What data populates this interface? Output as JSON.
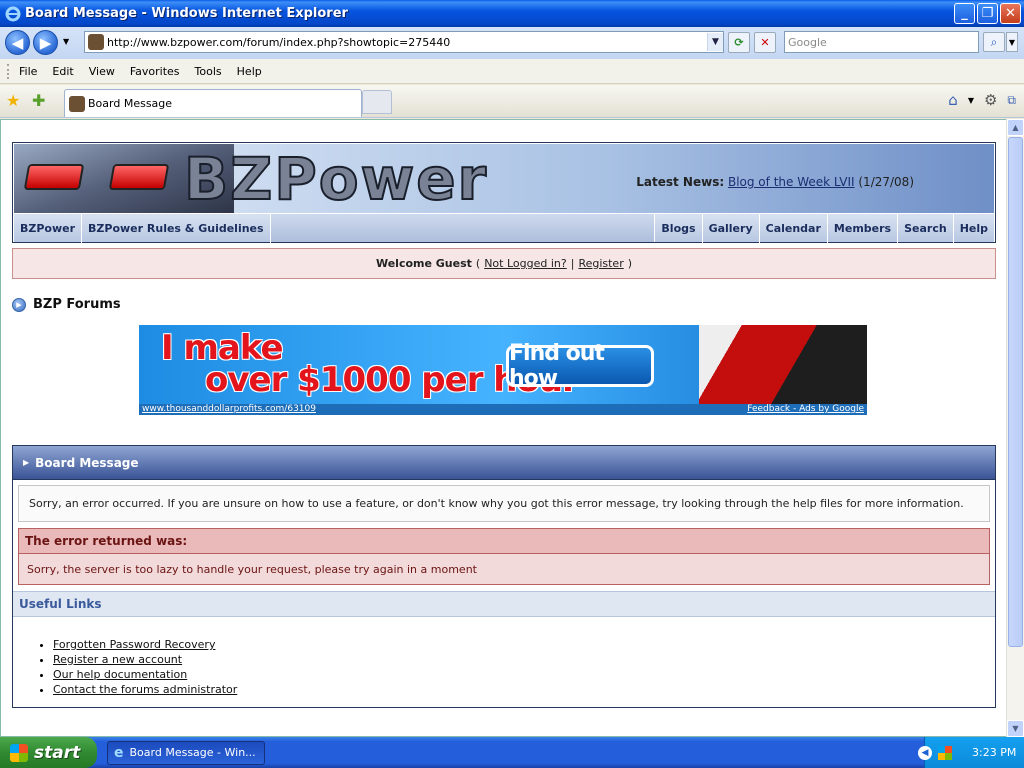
{
  "window": {
    "title": "Board Message - Windows Internet Explorer",
    "min": "_",
    "max": "❐",
    "close": "✕"
  },
  "address": {
    "url": "http://www.bzpower.com/forum/index.php?showtopic=275440"
  },
  "search": {
    "placeholder": "Google"
  },
  "menu": [
    "File",
    "Edit",
    "View",
    "Favorites",
    "Tools",
    "Help"
  ],
  "tab": {
    "label": "Board Message"
  },
  "site": {
    "logo": "BZPower",
    "news_label": "Latest News:",
    "news_link": "Blog of the Week LVII",
    "news_date": "(1/27/08)",
    "nav_left": [
      "BZPower",
      "BZPower Rules & Guidelines"
    ],
    "nav_right": [
      "Blogs",
      "Gallery",
      "Calendar",
      "Members",
      "Search",
      "Help"
    ]
  },
  "welcome": {
    "greeting": "Welcome Guest",
    "open": "(",
    "not_logged": "Not Logged in?",
    "sep": "|",
    "register": "Register",
    "close": ")"
  },
  "crumb": "BZP Forums",
  "ad": {
    "line1": "I make",
    "line2": "over $1000 per hour",
    "cta": "Find out how",
    "url": "www.thousanddollarprofits.com/63109",
    "feedback": "Feedback - Ads by Google"
  },
  "board": {
    "title": "Board Message",
    "message": "Sorry, an error occurred. If you are unsure on how to use a feature, or don't know why you got this error message, try looking through the help files for more information.",
    "error_title": "The error returned was:",
    "error_text": "Sorry, the server is too lazy to handle your request, please try again in a moment",
    "useful_title": "Useful Links",
    "links": [
      "Forgotten Password Recovery",
      "Register a new account",
      "Our help documentation",
      "Contact the forums administrator"
    ]
  },
  "taskbar": {
    "start": "start",
    "item": "Board Message - Win...",
    "time": "3:23 PM"
  }
}
